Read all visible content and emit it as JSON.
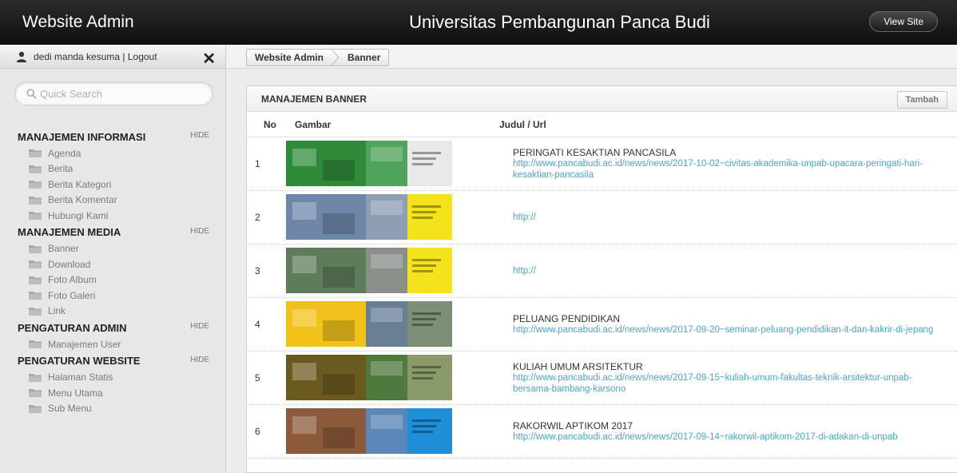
{
  "header": {
    "brand": "Website Admin",
    "site_title": "Universitas Pembangunan Panca Budi",
    "view_site_label": "View Site"
  },
  "user": {
    "text": "dedi manda kesuma | Logout",
    "close_glyph": "✕"
  },
  "search": {
    "placeholder": "Quick Search"
  },
  "nav": {
    "hide_label": "HIDE",
    "sections": [
      {
        "title": "MANAJEMEN INFORMASI",
        "items": [
          "Agenda",
          "Berita",
          "Berita Kategori",
          "Berita Komentar",
          "Hubungi Kami"
        ]
      },
      {
        "title": "MANAJEMEN MEDIA",
        "items": [
          "Banner",
          "Download",
          "Foto Album",
          "Foto Galeri",
          "Link"
        ]
      },
      {
        "title": "PENGATURAN ADMIN",
        "items": [
          "Manajemen User"
        ]
      },
      {
        "title": "PENGATURAN WEBSITE",
        "items": [
          "Halaman Statis",
          "Menu Utama",
          "Sub Menu"
        ]
      }
    ]
  },
  "breadcrumb": [
    "Website Admin",
    "Banner"
  ],
  "panel": {
    "title": "MANAJEMEN BANNER",
    "add_label": "Tambah",
    "columns": {
      "no": "No",
      "image": "Gambar",
      "title": "Judul / Url"
    }
  },
  "rows": [
    {
      "no": "1",
      "title": "PERINGATI KESAKTIAN PANCASILA",
      "url": "http://www.pancabudi.ac.id/news/news/2017-10-02~civitas-akademika-unpab-upacara-peringati-hari-kesaktian-pancasila",
      "thumb_colors": [
        "#2f8a3a",
        "#4fa35a",
        "#e9e9e9"
      ]
    },
    {
      "no": "2",
      "title": "",
      "url": "http://",
      "thumb_colors": [
        "#6e86a8",
        "#8f9fb3",
        "#f4e31a"
      ]
    },
    {
      "no": "3",
      "title": "",
      "url": "http://",
      "thumb_colors": [
        "#5e7b5a",
        "#8a8f8a",
        "#f4e31a"
      ]
    },
    {
      "no": "4",
      "title": "PELUANG PENDIDIKAN",
      "url": "http://www.pancabudi.ac.id/news/news/2017-09-20~seminar-peluang-pendidikan-it-dan-kakrir-di-jepang",
      "thumb_colors": [
        "#f0c21a",
        "#6a7f96",
        "#7c8f74"
      ]
    },
    {
      "no": "5",
      "title": "KULIAH UMUM ARSITEKTUR",
      "url": "http://www.pancabudi.ac.id/news/news/2017-09-15~kuliah-umum-fakultas-teknik-arsitektur-unpab-bersama-bambang-karsono",
      "thumb_colors": [
        "#6b5a1f",
        "#4f7a3e",
        "#8a9a6a"
      ]
    },
    {
      "no": "6",
      "title": "RAKORWIL APTIKOM 2017",
      "url": "http://www.pancabudi.ac.id/news/news/2017-09-14~rakorwil-aptikom-2017-di-adakan-di-unpab",
      "thumb_colors": [
        "#8a5a3a",
        "#5a86b8",
        "#1e8fd6"
      ]
    }
  ]
}
